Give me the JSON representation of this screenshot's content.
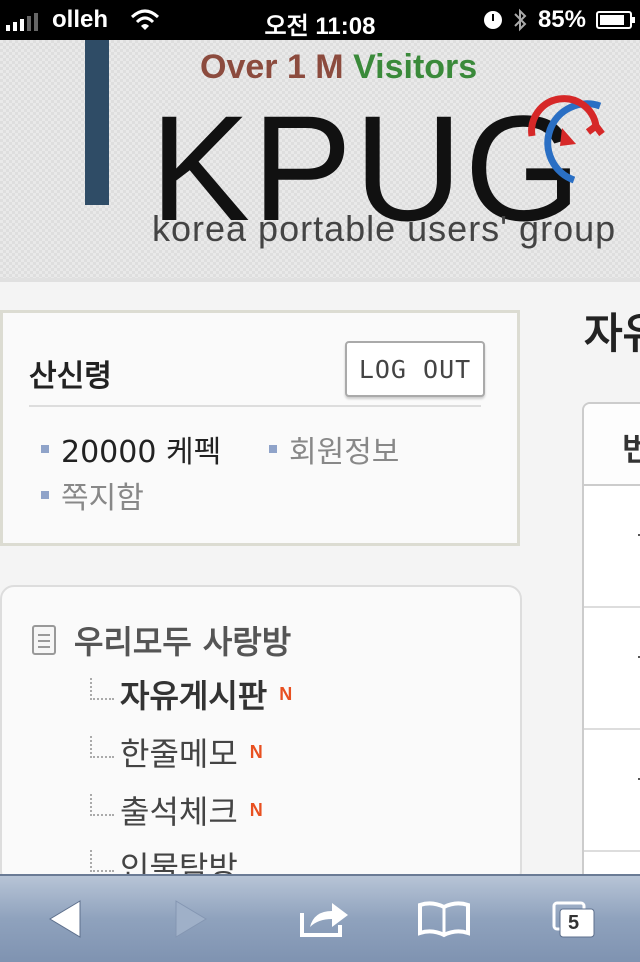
{
  "status_bar": {
    "carrier": "olleh",
    "time": "오전 11:08",
    "battery_text": "85%",
    "battery_level": 0.85
  },
  "header": {
    "tagline_prefix": "Over 1 M ",
    "tagline_suffix": "Visitors",
    "logo_text": "KPUG",
    "subtitle": "korea portable users' group"
  },
  "user_box": {
    "username": "산신령",
    "logout_label": "LOG OUT",
    "points": "20000 케펙",
    "member_info": "회원정보",
    "messages": "쪽지함"
  },
  "menu": {
    "section_title": "우리모두 사랑방",
    "items": [
      {
        "label": "자유게시판",
        "badge": "N"
      },
      {
        "label": "한줄메모",
        "badge": "N"
      },
      {
        "label": "출석체크",
        "badge": "N"
      },
      {
        "label": "인물탐방"
      }
    ]
  },
  "content": {
    "title_partial": "자유",
    "table_header_partial": "번"
  },
  "toolbar": {
    "tabs_count": "5",
    "icons": [
      "back-arrow-icon",
      "forward-arrow-icon",
      "share-icon",
      "bookmarks-icon",
      "tabs-icon"
    ]
  },
  "colors": {
    "accent_stripe": "#2f4c66",
    "new_badge": "#e85020",
    "bullet": "#8fa3c9"
  }
}
